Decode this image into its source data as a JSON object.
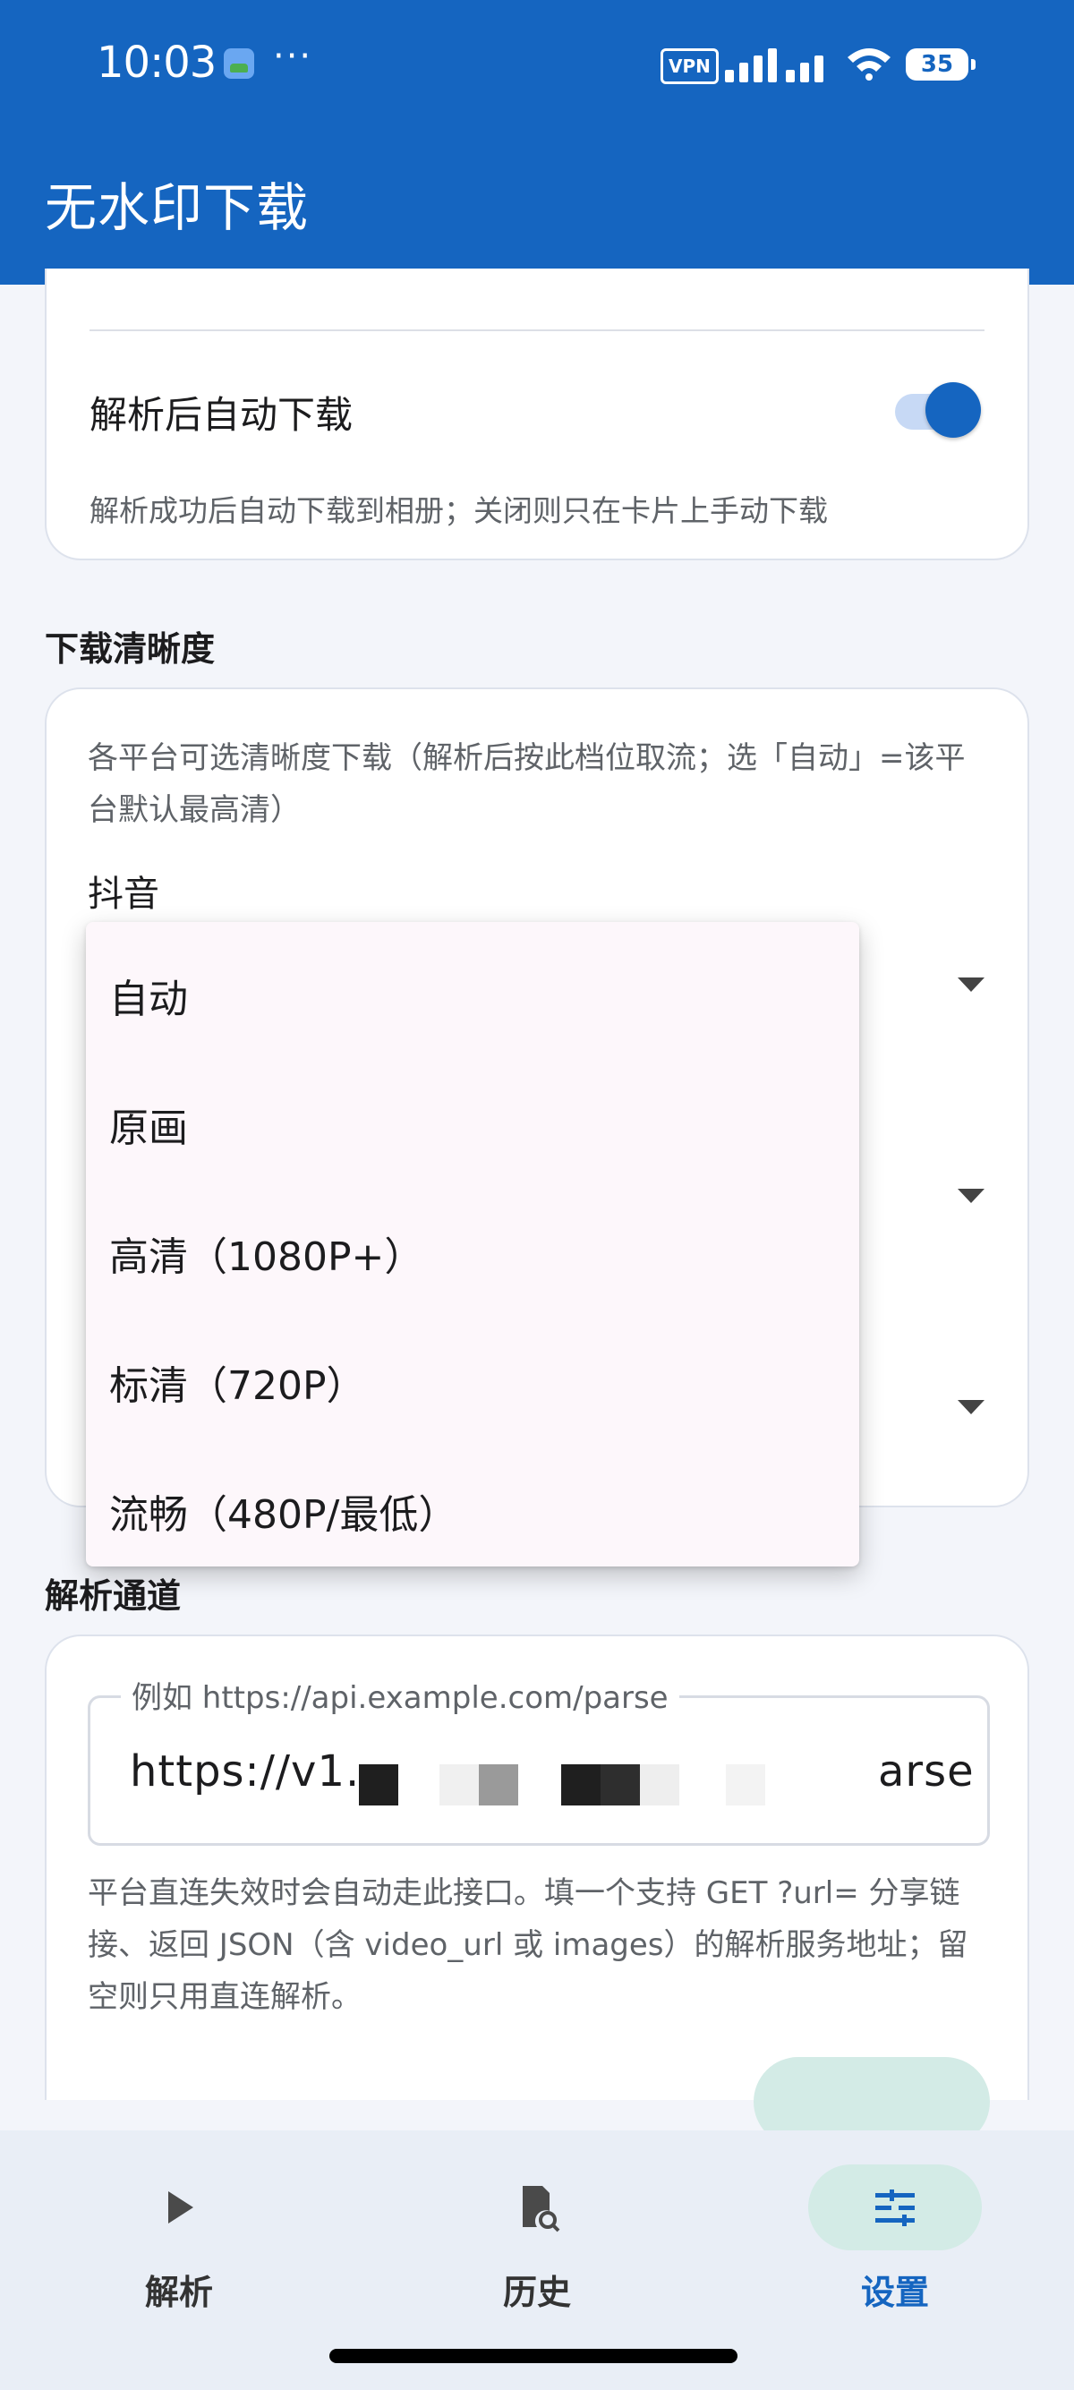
{
  "status_bar": {
    "time": "10:03",
    "more": "···",
    "vpn": "VPN",
    "battery": "35"
  },
  "app_bar": {
    "title": "无水印下载"
  },
  "auto_download": {
    "title": "解析后自动下载",
    "subtitle": "解析成功后自动下载到相册；关闭则只在卡片上手动下载",
    "enabled": true
  },
  "quality_section": {
    "label": "下载清晰度",
    "description": "各平台可选清晰度下载（解析后按此档位取流；选「自动」=该平台默认最高清）",
    "platform": "抖音"
  },
  "quality_menu": {
    "items": [
      "自动",
      "原画",
      "高清（1080P+）",
      "标清（720P）",
      "流畅（480P/最低）"
    ]
  },
  "channel_section": {
    "label": "解析通道",
    "field_label": "例如 https://api.example.com/parse",
    "field_value_start": "https://v1.",
    "field_value_end": "arse",
    "description": "平台直连失效时会自动走此接口。填一个支持 GET ?url= 分享链接、返回 JSON（含 video_url 或 images）的解析服务地址；留空则只用直连解析。"
  },
  "bottom_nav": {
    "items": [
      {
        "label": "解析",
        "icon": "play-icon",
        "active": false
      },
      {
        "label": "历史",
        "icon": "history-icon",
        "active": false
      },
      {
        "label": "设置",
        "icon": "settings-icon",
        "active": true
      }
    ]
  },
  "colors": {
    "primary": "#1565c0",
    "active_pill": "#d3ebe6",
    "background": "#f3f5fa"
  }
}
